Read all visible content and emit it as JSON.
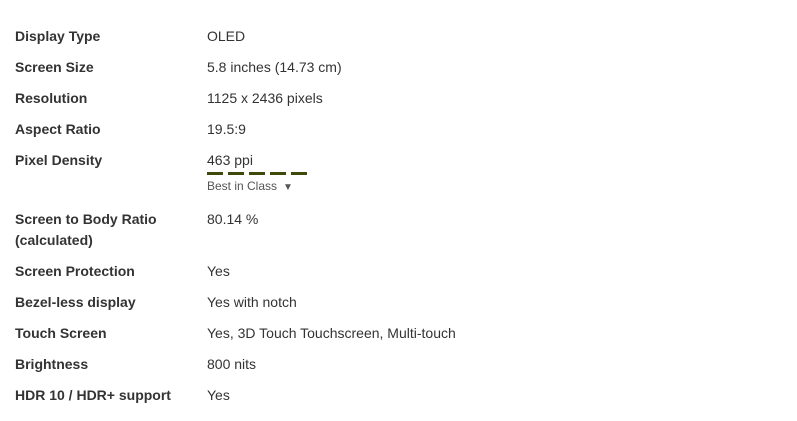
{
  "specs": [
    {
      "label": "Display Type",
      "value": "OLED"
    },
    {
      "label": "Screen Size",
      "value": "5.8 inches (14.73 cm)"
    },
    {
      "label": "Resolution",
      "value": "1125 x 2436 pixels"
    },
    {
      "label": "Aspect Ratio",
      "value": "19.5:9"
    },
    {
      "label": "Pixel Density",
      "value": "463 ppi"
    },
    {
      "label": "Screen to Body Ratio (calculated)",
      "value": "80.14 %"
    },
    {
      "label": "Screen Protection",
      "value": "Yes"
    },
    {
      "label": "Bezel-less display",
      "value": "Yes with notch"
    },
    {
      "label": "Touch Screen",
      "value": "Yes, 3D Touch Touchscreen, Multi-touch"
    },
    {
      "label": "Brightness",
      "value": "800 nits"
    },
    {
      "label": "HDR 10 / HDR+ support",
      "value": "Yes"
    }
  ],
  "pixel_density": {
    "rating_filled": 5,
    "rating_total": 5,
    "rating_color": "#3d4a0a",
    "badge_label": "Best in Class",
    "badge_arrow": "▼"
  }
}
